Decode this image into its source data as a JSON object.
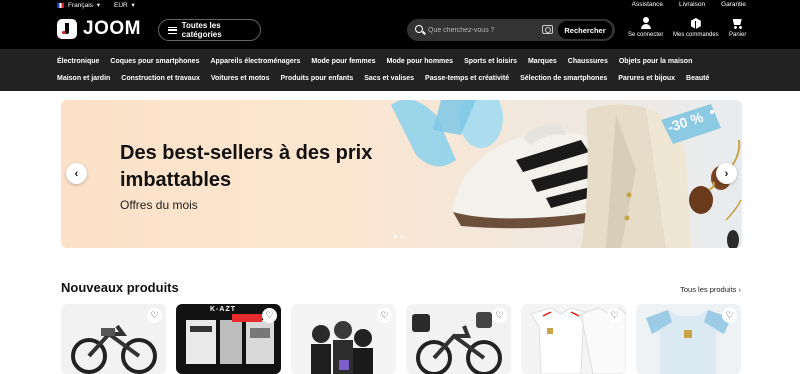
{
  "topbar": {
    "language": "Français",
    "currency": "EUR",
    "links": [
      "Assistance",
      "Livraison",
      "Garantie"
    ]
  },
  "header": {
    "logo_text": "JOOM",
    "categories_button": "Toutes les catégories",
    "search": {
      "placeholder": "Que cherchez-vous ?",
      "button": "Rechercher"
    },
    "actions": [
      {
        "label": "Se connecter",
        "icon": "user-icon"
      },
      {
        "label": "Mes commandes",
        "icon": "box-icon"
      },
      {
        "label": "Panier",
        "icon": "cart-icon"
      }
    ]
  },
  "nav": {
    "row1": [
      "Électronique",
      "Coques pour smartphones",
      "Appareils électroménagers",
      "Mode pour femmes",
      "Mode pour hommes",
      "Sports et loisirs",
      "Marques",
      "Chaussures",
      "Objets pour la maison"
    ],
    "row2": [
      "Maison et jardin",
      "Construction et travaux",
      "Voitures et motos",
      "Produits pour enfants",
      "Sacs et valises",
      "Passe-temps et créativité",
      "Sélection de smartphones",
      "Parures et bijoux",
      "Beauté"
    ]
  },
  "banner": {
    "title": "Des best-sellers à des prix imbattables",
    "subtitle": "Offres du mois",
    "discount_badge": "-30 %",
    "prev_icon": "chevron-left-icon",
    "next_icon": "chevron-right-icon"
  },
  "new_products": {
    "title": "Nouveaux produits",
    "all_link": "Tous les produits",
    "cards": [
      {
        "name": "e-bike-card",
        "bg": "#f1f1f1"
      },
      {
        "name": "k-azt-card",
        "bg": "#111111",
        "text": "K-AZT"
      },
      {
        "name": "group-photo-card",
        "bg": "#eeeeee"
      },
      {
        "name": "e-bike-card-2",
        "bg": "#f1f1f1"
      },
      {
        "name": "white-jersey-card",
        "bg": "#f4f4f4"
      },
      {
        "name": "blue-jersey-card",
        "bg": "#eef2f5"
      }
    ]
  },
  "colors": {
    "header_bg": "#000000",
    "nav_bg": "#222222",
    "banner_bg": "#fce6cf"
  }
}
